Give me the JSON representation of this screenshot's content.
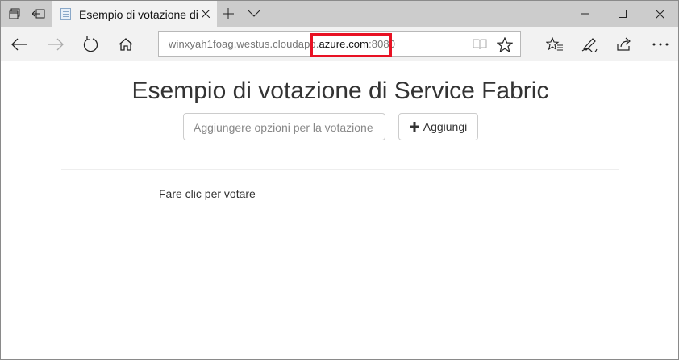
{
  "browser": {
    "tab": {
      "title": "Esempio di votazione di"
    },
    "address": {
      "url_prefix": "winxyah1foag.westus.cloudapp.",
      "url_domain": "azure.com",
      "url_port": ":8080"
    }
  },
  "page": {
    "title": "Esempio di votazione di Service Fabric",
    "input_placeholder": "Aggiungere opzioni per la votazione",
    "add_button_label": "Aggiungi",
    "vote_prompt": "Fare clic per votare"
  },
  "colors": {
    "tabbar_bg": "#cccccc",
    "navbar_bg": "#f2f2f2",
    "highlight_border": "#e81123"
  },
  "icons": [
    "tabs-aside-icon",
    "set-aside-icon",
    "page-icon",
    "close-icon",
    "plus-icon",
    "chevron-down-icon",
    "minimize-icon",
    "maximize-icon",
    "back-arrow-icon",
    "forward-arrow-icon",
    "refresh-icon",
    "home-icon",
    "reading-view-icon",
    "star-icon",
    "favorites-icon",
    "pen-icon",
    "share-icon",
    "more-icon"
  ]
}
